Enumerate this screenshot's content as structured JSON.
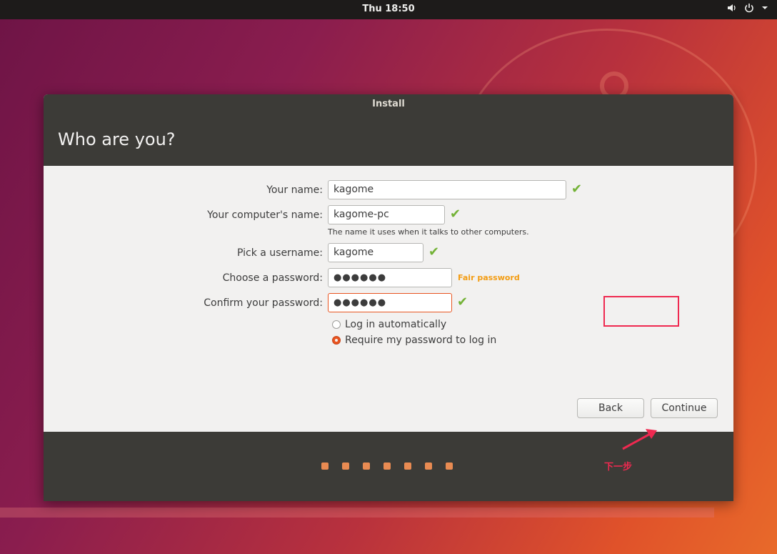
{
  "topbar": {
    "clock": "Thu 18:50",
    "icons": [
      "volume-icon",
      "power-icon",
      "chevron-down-icon"
    ]
  },
  "window": {
    "title": "Install",
    "heading": "Who are you?"
  },
  "form": {
    "name_label": "Your name:",
    "name_value": "kagome",
    "computer_label": "Your computer's name:",
    "computer_value": "kagome-pc",
    "computer_hint": "The name it uses when it talks to other computers.",
    "username_label": "Pick a username:",
    "username_value": "kagome",
    "password_label": "Choose a password:",
    "password_value": "●●●●●●",
    "password_strength": "Fair password",
    "confirm_label": "Confirm your password:",
    "confirm_value": "●●●●●●",
    "login_auto": "Log in automatically",
    "login_require": "Require my password to log in",
    "selected_login": "login_require"
  },
  "buttons": {
    "back": "Back",
    "continue": "Continue"
  },
  "progress": {
    "steps": 7
  },
  "annotation": {
    "text": "下一步"
  },
  "colors": {
    "accent": "#e95420",
    "check": "#73b236",
    "strength": "#f39c12",
    "annotation": "#ef2950"
  }
}
